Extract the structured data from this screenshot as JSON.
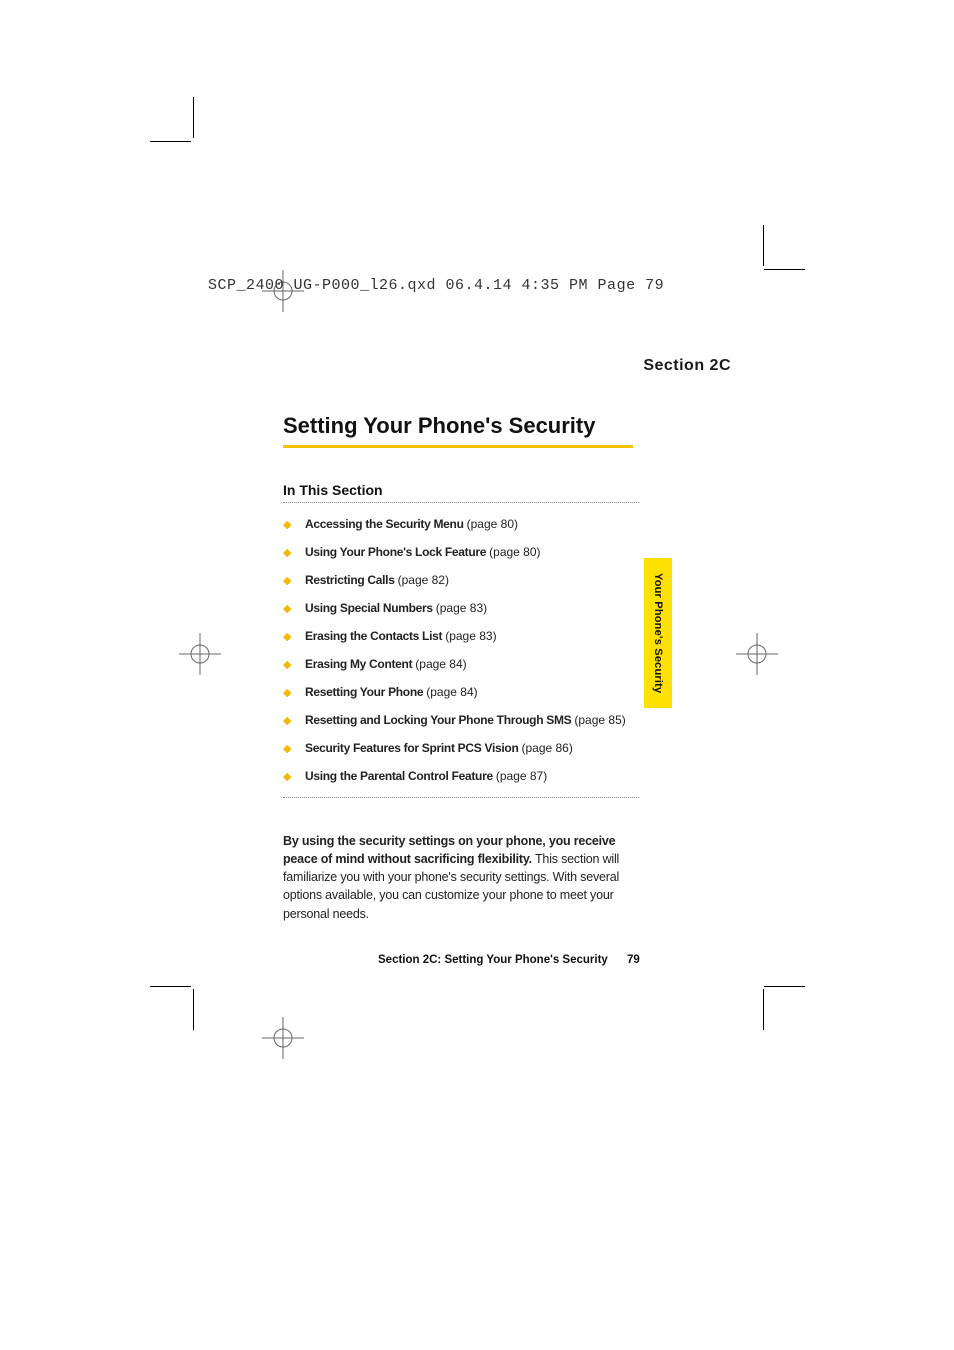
{
  "header_slug": "SCP_2400 UG-P000_l26.qxd  06.4.14  4:35 PM  Page 79",
  "section_label": "Section 2C",
  "title": "Setting Your Phone's Security",
  "subhead": "In This Section",
  "toc": [
    {
      "label": "Accessing the Security Menu",
      "page": "(page 80)"
    },
    {
      "label": "Using Your Phone's Lock Feature",
      "page": "(page 80)"
    },
    {
      "label": "Restricting Calls",
      "page": "(page 82)"
    },
    {
      "label": "Using Special Numbers",
      "page": "(page 83)"
    },
    {
      "label": "Erasing the Contacts List",
      "page": "(page 83)"
    },
    {
      "label": "Erasing My Content",
      "page": "(page 84)"
    },
    {
      "label": "Resetting Your Phone",
      "page": "(page 84)"
    },
    {
      "label": "Resetting and Locking Your Phone Through SMS",
      "page": "(page 85)"
    },
    {
      "label": "Security Features for Sprint PCS Vision",
      "page": "(page 86)"
    },
    {
      "label": "Using the Parental Control Feature",
      "page": "(page 87)"
    }
  ],
  "body": {
    "lead": "By using the security settings on your phone, you receive peace of mind without sacrificing flexibility.",
    "rest": " This section will familiarize you with your phone's security settings. With several options available, you can customize your phone to meet your personal needs."
  },
  "footer": {
    "text": "Section 2C: Setting Your Phone's Security",
    "page_number": "79"
  },
  "side_tab": "Your Phone's Security"
}
